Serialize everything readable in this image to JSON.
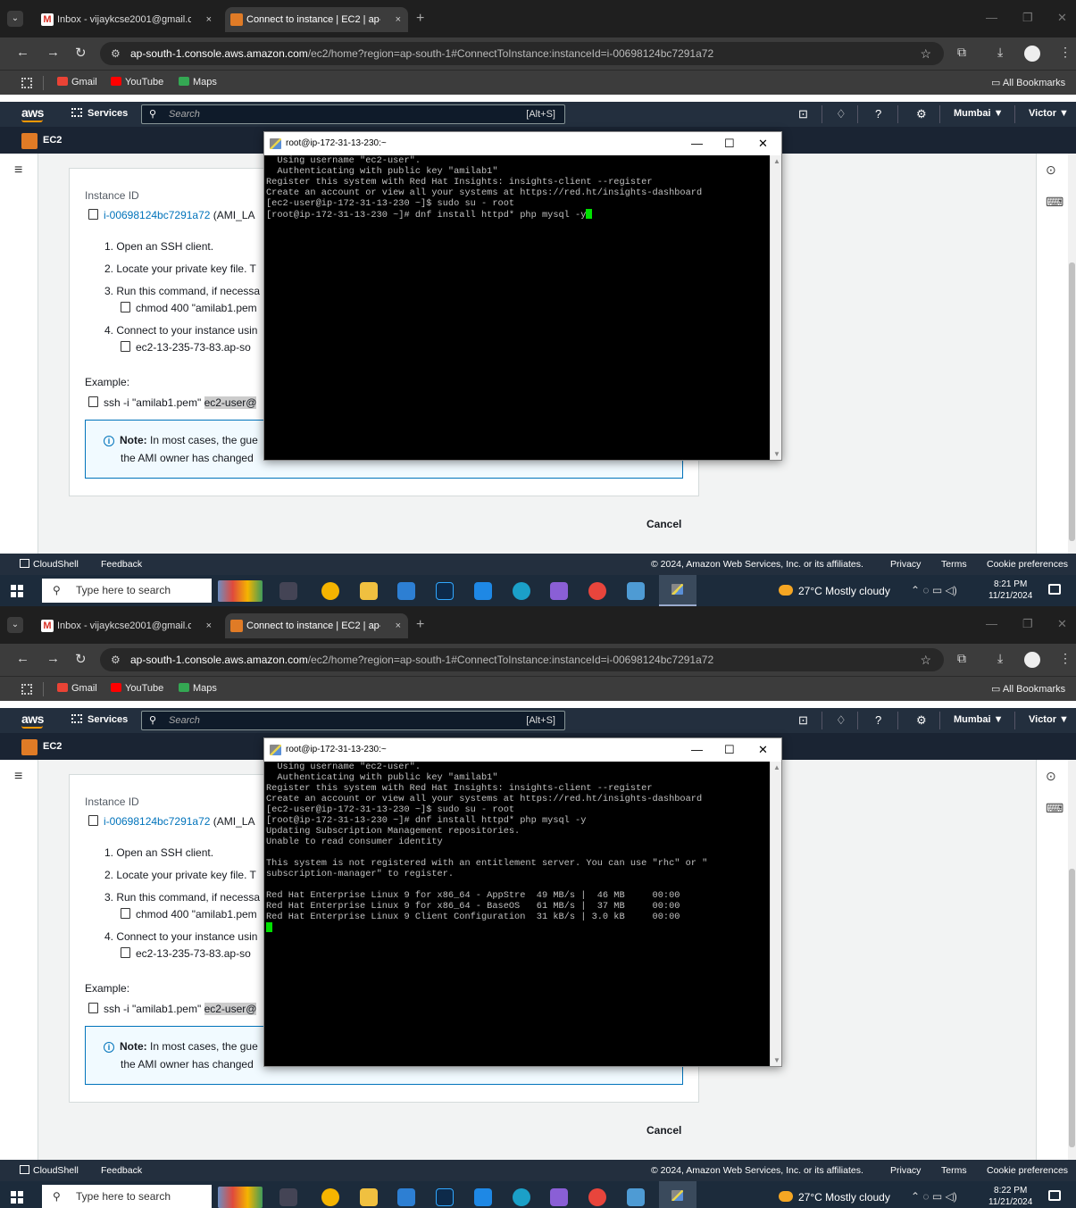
{
  "browser": {
    "tabs": [
      {
        "title": "Inbox - vijaykcse2001@gmail.c",
        "close": "×"
      },
      {
        "title": "Connect to instance | EC2 | ap-s",
        "close": "×"
      }
    ],
    "gmail_favicon": "M",
    "new_tab": "+",
    "url_host": "ap-south-1.console.aws.amazon.com",
    "url_path": "/ec2/home?region=ap-south-1#ConnectToInstance:instanceId=i-00698124bc7291a72",
    "bookmarks": [
      "Gmail",
      "YouTube",
      "Maps"
    ],
    "all_bookmarks": "All Bookmarks"
  },
  "aws": {
    "logo": "aws",
    "services": "Services",
    "search_placeholder": "Search",
    "search_shortcut": "[Alt+S]",
    "region": "Mumbai ▼",
    "user": "Victor ▼",
    "service_name": "EC2"
  },
  "card": {
    "instance_id_label": "Instance ID",
    "instance_id_value": "i-00698124bc7291a72",
    "instance_id_suffix": " (AMI_LA",
    "step1": "1. Open an SSH client.",
    "step2": "2. Locate your private key file. T",
    "step3": "3. Run this command, if necessa",
    "step3_cmd": "chmod 400 \"amilab1.pem",
    "step4": "4. Connect to your instance usin",
    "step4_cmd": "ec2-13-235-73-83.ap-so",
    "example_label": "Example:",
    "example_cmd_prefix": "ssh -i \"amilab1.pem\" ",
    "example_cmd_highlight": "ec2-user@",
    "note_label": "Note:",
    "note_text": " In most cases, the gue",
    "note_line2": "the AMI owner has changed",
    "cancel": "Cancel"
  },
  "footer": {
    "cloudshell": "CloudShell",
    "feedback": "Feedback",
    "copyright": "© 2024, Amazon Web Services, Inc. or its affiliates.",
    "privacy": "Privacy",
    "terms": "Terms",
    "cookies": "Cookie preferences"
  },
  "taskbar": {
    "search_placeholder": "Type here to search",
    "weather": "27°C  Mostly cloudy"
  },
  "terminal": {
    "title": "root@ip-172-31-13-230:~"
  },
  "shots": [
    {
      "time": "8:21 PM",
      "date": "11/21/2024",
      "lines": [
        "  Using username \"ec2-user\".",
        "  Authenticating with public key \"amilab1\"",
        "Register this system with Red Hat Insights: insights-client --register",
        "Create an account or view all your systems at https://red.ht/insights-dashboard",
        "[ec2-user@ip-172-31-13-230 ~]$ sudo su - root",
        "[root@ip-172-31-13-230 ~]# dnf install httpd* php mysql -y"
      ]
    },
    {
      "time": "8:22 PM",
      "date": "11/21/2024",
      "lines": [
        "  Using username \"ec2-user\".",
        "  Authenticating with public key \"amilab1\"",
        "Register this system with Red Hat Insights: insights-client --register",
        "Create an account or view all your systems at https://red.ht/insights-dashboard",
        "[ec2-user@ip-172-31-13-230 ~]$ sudo su - root",
        "[root@ip-172-31-13-230 ~]# dnf install httpd* php mysql -y",
        "Updating Subscription Management repositories.",
        "Unable to read consumer identity",
        "",
        "This system is not registered with an entitlement server. You can use \"rhc\" or \"",
        "subscription-manager\" to register.",
        "",
        "Red Hat Enterprise Linux 9 for x86_64 - AppStre  49 MB/s |  46 MB     00:00",
        "Red Hat Enterprise Linux 9 for x86_64 - BaseOS   61 MB/s |  37 MB     00:00",
        "Red Hat Enterprise Linux 9 Client Configuration  31 kB/s | 3.0 kB     00:00",
        ""
      ]
    }
  ]
}
